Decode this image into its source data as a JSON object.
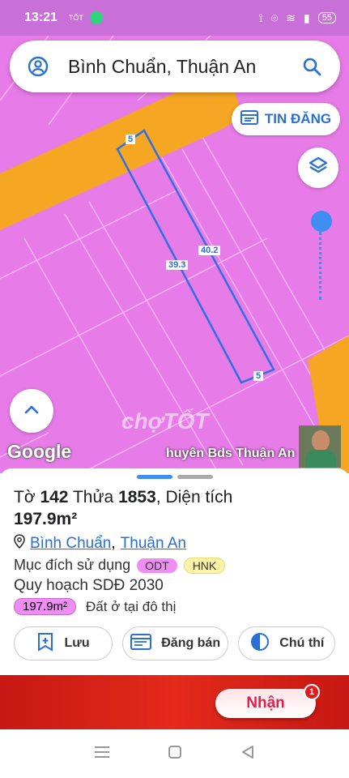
{
  "status_bar": {
    "time": "13:21",
    "mini_label": "TỐT",
    "battery": "55",
    "icons": [
      "chat-icon",
      "vibrate-icon",
      "location-icon",
      "wifi-icon",
      "signal-icon",
      "battery-icon"
    ]
  },
  "search": {
    "text": "Bình Chuẩn, Thuận An",
    "left_icon": "account-icon",
    "right_icon": "search-icon"
  },
  "map": {
    "tin_dang_label": "TIN ĐĂNG",
    "edge_labels": [
      "5",
      "40.2",
      "39.3",
      "5"
    ],
    "watermark": "chợTỐT",
    "google_label": "Google",
    "channel_label": "huyên Bds Thuận An",
    "colors": {
      "land": "#e77ce9",
      "road": "#f5a623",
      "lot_outline": "#2f6fe0"
    }
  },
  "parcel": {
    "to_prefix": "Tờ",
    "to_number": "142",
    "thua_prefix": "Thửa",
    "thua_number": "1853",
    "dien_tich_label": ", Diện tích",
    "area": "197.9m²",
    "location_ward": "Bình Chuẩn",
    "location_separator": ",",
    "location_city": "Thuận An",
    "purpose_label": "Mục đích sử dụng",
    "purpose_tags": [
      "ODT",
      "HNK"
    ],
    "plan_label": "Quy hoạch SDĐ 2030",
    "plan_area": "197.9m²",
    "plan_desc": "Đất ở tại đô thị"
  },
  "actions": {
    "save": "Lưu",
    "post": "Đăng bán",
    "note": "Chú thí"
  },
  "banner": {
    "claim_label": "Nhận",
    "badge_count": "1"
  }
}
